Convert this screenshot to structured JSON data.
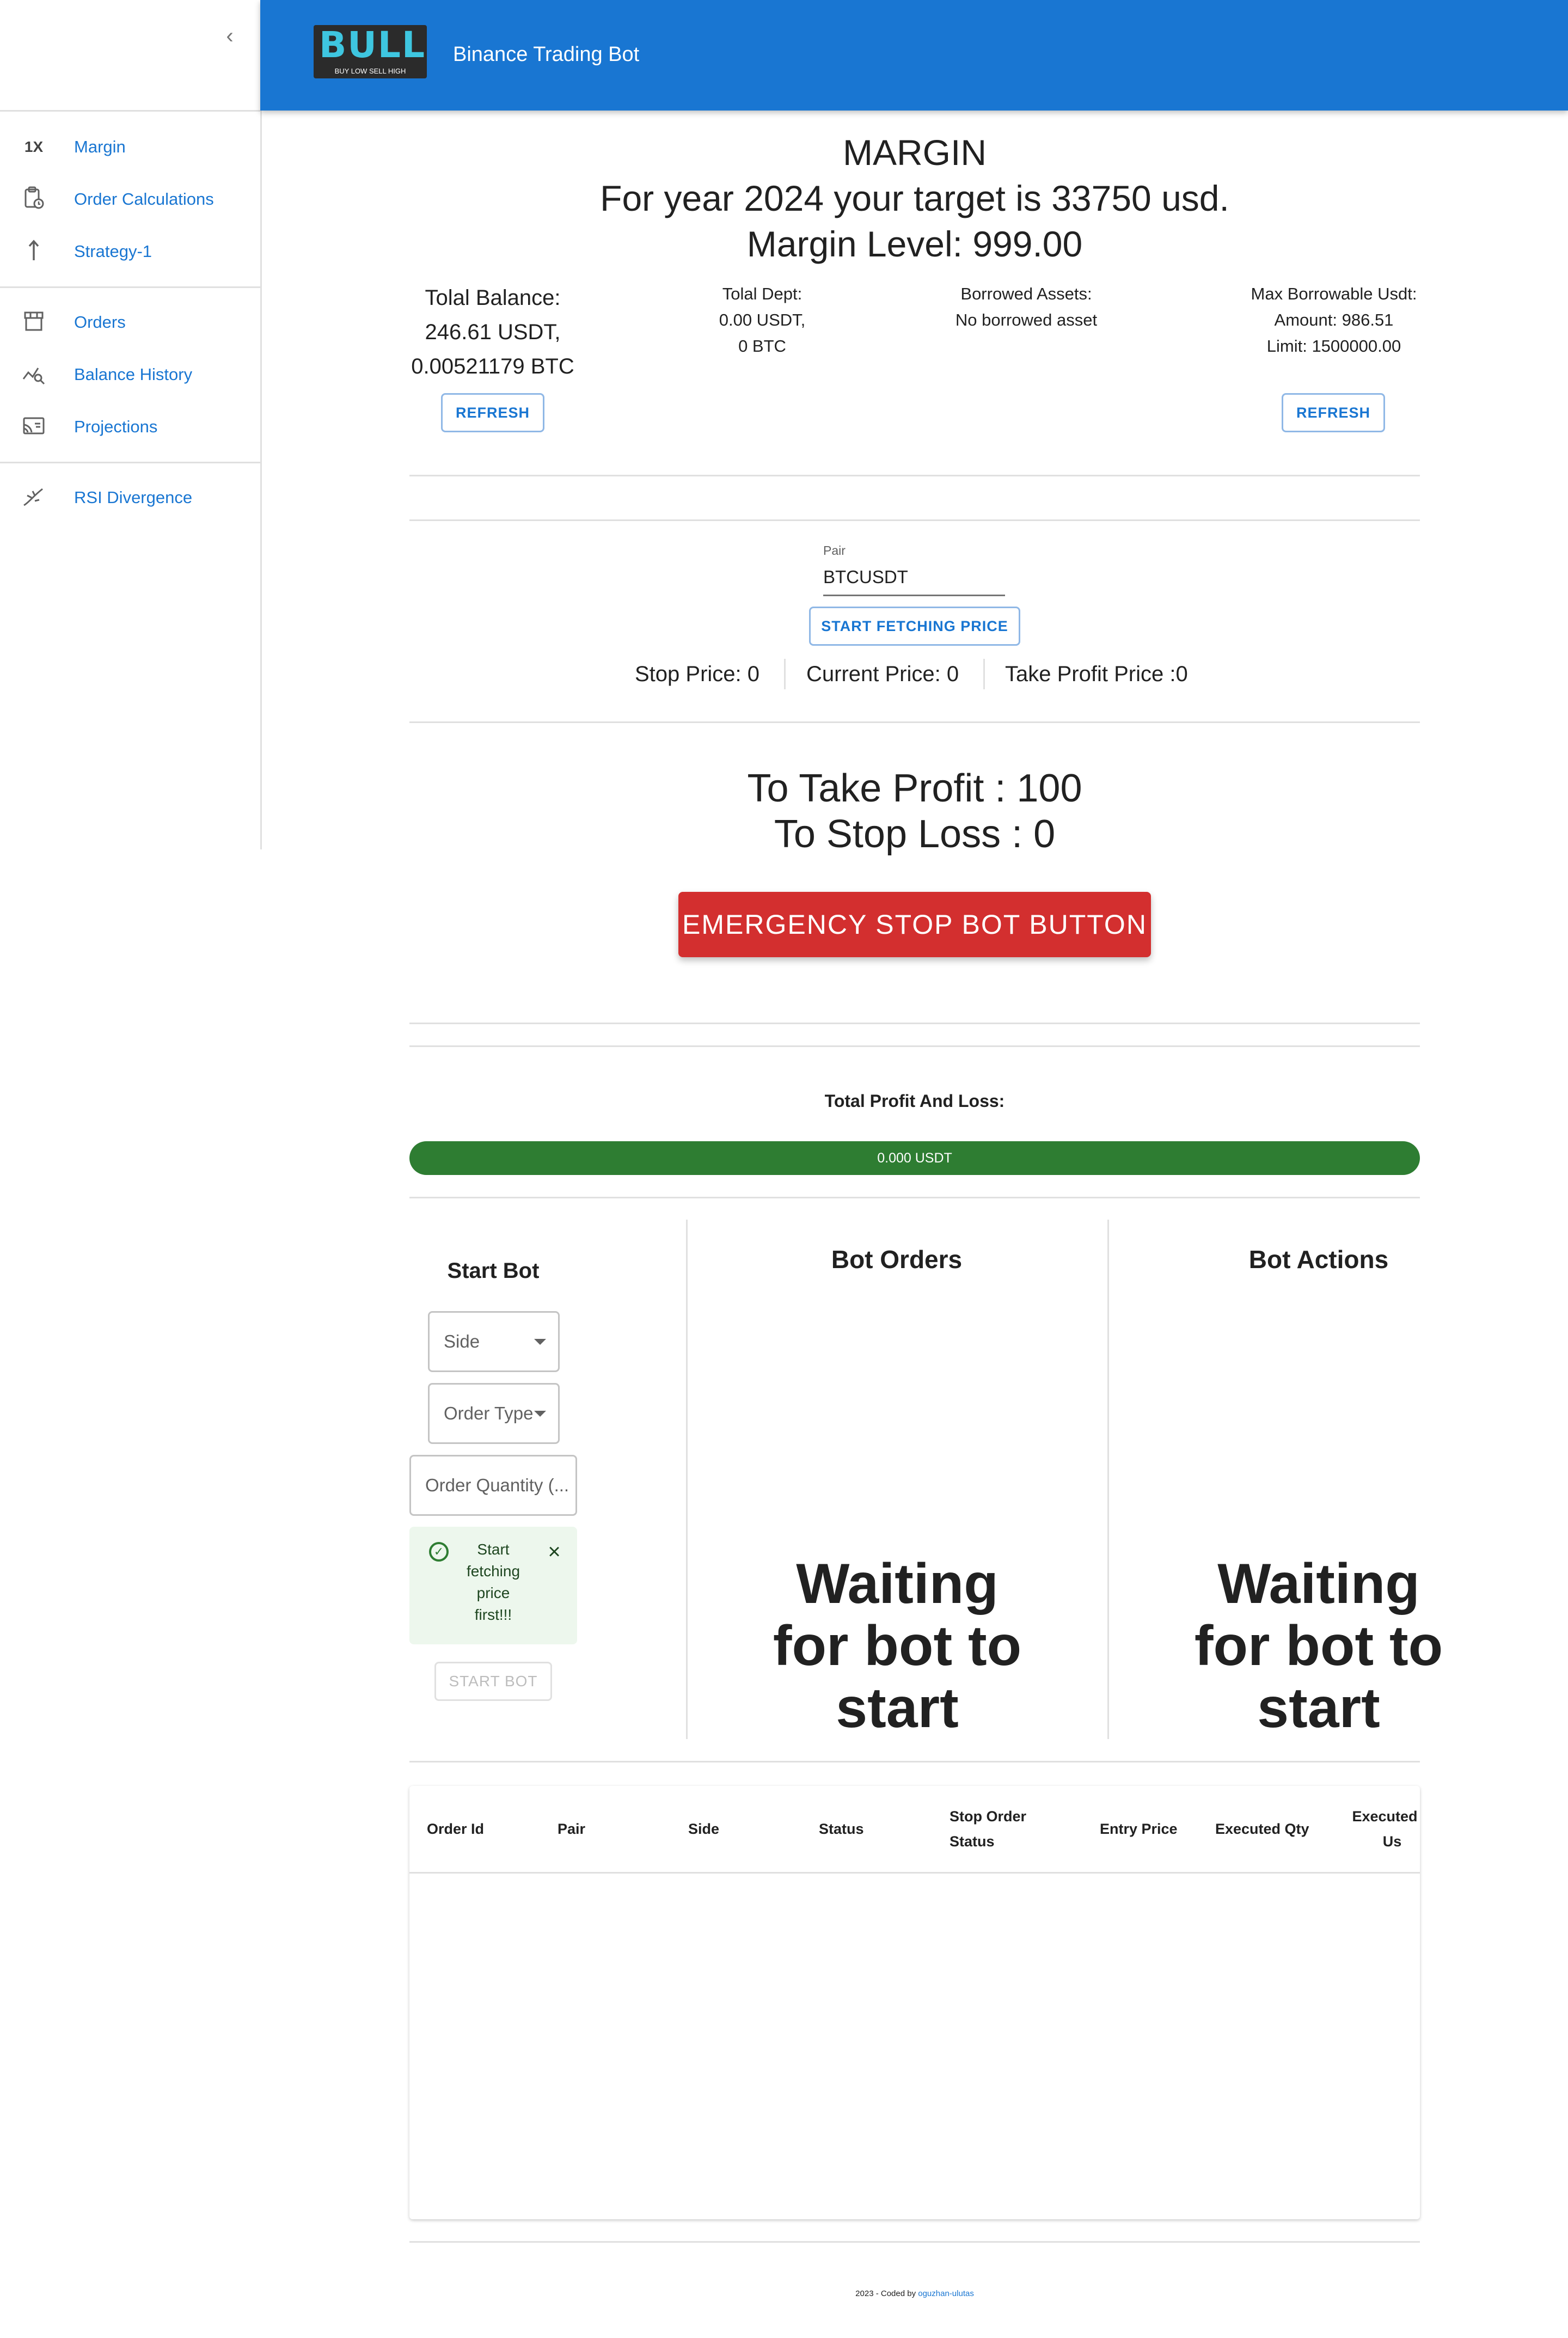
{
  "appbar": {
    "title": "Binance Trading Bot",
    "logo_text": "BULL",
    "logo_tagline": "BUY LOW SELL HIGH"
  },
  "drawer": {
    "collapse_icon": "chevron-left-icon",
    "items": [
      {
        "icon": "1X",
        "label": "Margin"
      },
      {
        "icon": "clipboard-clock-icon",
        "label": "Order Calculations"
      },
      {
        "icon": "arrow-up-icon",
        "label": "Strategy-1"
      },
      {
        "icon": "storefront-icon",
        "label": "Orders"
      },
      {
        "icon": "query-stats-icon",
        "label": "Balance History"
      },
      {
        "icon": "cast-projection-icon",
        "label": "Projections"
      },
      {
        "icon": "divergence-icon",
        "label": "RSI Divergence"
      }
    ]
  },
  "header": {
    "line1": "MARGIN",
    "line2": "For year 2024 your target is 33750 usd.",
    "line3": "Margin Level: 999.00"
  },
  "balance": {
    "line1": "Tolal Balance:",
    "line2": "246.61 USDT,",
    "line3": "0.00521179 BTC",
    "refresh_label": "REFRESH"
  },
  "debt": {
    "line1": "Tolal Dept:",
    "line2": "0.00 USDT,",
    "line3": "0 BTC"
  },
  "borrowed": {
    "line1": "Borrowed Assets:",
    "line2": "No borrowed asset"
  },
  "max_borrow": {
    "line1": "Max Borrowable Usdt:",
    "line2": "Amount: 986.51",
    "line3": "Limit: 1500000.00",
    "refresh_label": "REFRESH"
  },
  "pair": {
    "label": "Pair",
    "value": "BTCUSDT",
    "fetch_label": "START FETCHING PRICE"
  },
  "prices": {
    "stop": "Stop Price: 0",
    "current": "Current Price: 0",
    "take_profit": "Take Profit Price :0"
  },
  "targets": {
    "take_profit": "To Take Profit : 100",
    "stop_loss": "To Stop Loss : 0"
  },
  "emergency_label": "EMERGENCY STOP BOT BUTTON",
  "pnl": {
    "title": "Total Profit And Loss:",
    "value": "0.000 USDT",
    "color": "#2e7d32"
  },
  "start_bot": {
    "title": "Start Bot",
    "side_label": "Side",
    "order_type_label": "Order Type",
    "quantity_placeholder": "Order Quantity (...",
    "alert_message": "Start fetching price first!!!",
    "button_label": "START BOT"
  },
  "bot_orders": {
    "title": "Bot Orders",
    "waiting": "Waiting for bot to start"
  },
  "bot_actions": {
    "title": "Bot Actions",
    "waiting": "Waiting for bot to start"
  },
  "orders_table": {
    "columns": [
      "Order Id",
      "Pair",
      "Side",
      "Status",
      "Stop Order Status",
      "Entry Price",
      "Executed Qty",
      "Executed C Us"
    ]
  },
  "footer": {
    "prefix": "2023 - Coded by ",
    "author": "oguzhan-ulutas"
  },
  "colors": {
    "primary": "#1976d2",
    "error": "#d32f2f",
    "success": "#2e7d32"
  }
}
